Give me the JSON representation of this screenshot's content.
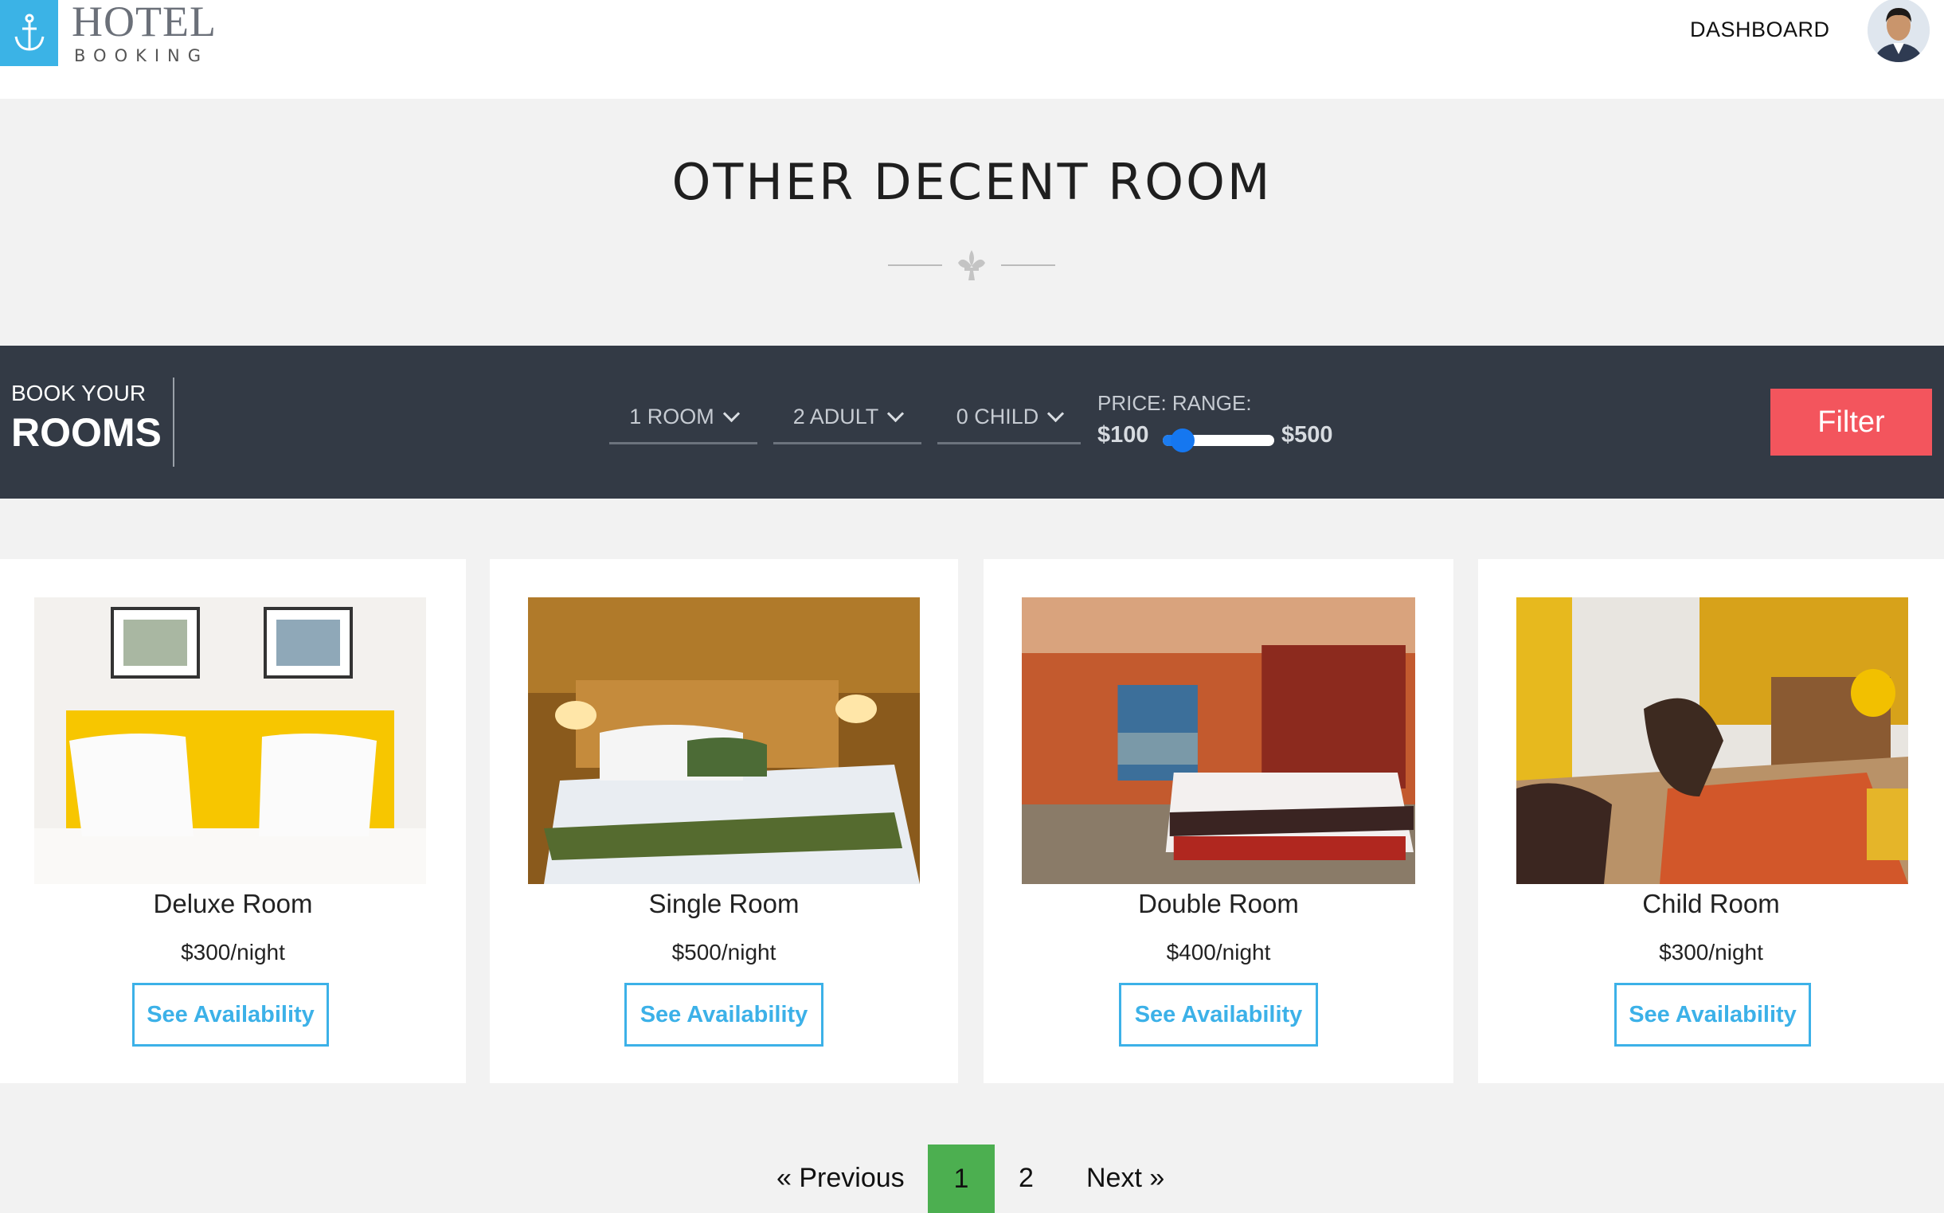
{
  "header": {
    "logo_title": "HOTEL",
    "logo_subtitle": "BOOKING",
    "dashboard_label": "DASHBOARD",
    "brand_color": "#3bb3e6"
  },
  "section": {
    "title": "OTHER DECENT ROOM"
  },
  "booking_bar": {
    "label_top": "BOOK YOUR",
    "label_bottom": "ROOMS",
    "room_select": "1 ROOM",
    "adult_select": "2 ADULT",
    "child_select": "0 CHILD",
    "price_label": "PRICE: RANGE:",
    "price_min": "$100",
    "price_max": "$500",
    "slider_value_fraction": 0.1,
    "filter_label": "Filter",
    "filter_color": "#f3555d"
  },
  "rooms": [
    {
      "name": "Deluxe Room",
      "price": "$300/night",
      "button": "See Availability"
    },
    {
      "name": "Single Room",
      "price": "$500/night",
      "button": "See Availability"
    },
    {
      "name": "Double Room",
      "price": "$400/night",
      "button": "See Availability"
    },
    {
      "name": "Child Room",
      "price": "$300/night",
      "button": "See Availability"
    }
  ],
  "pagination": {
    "prev": "« Previous",
    "pages": [
      "1",
      "2"
    ],
    "current": "1",
    "next": "Next »",
    "active_color": "#4caf50"
  }
}
